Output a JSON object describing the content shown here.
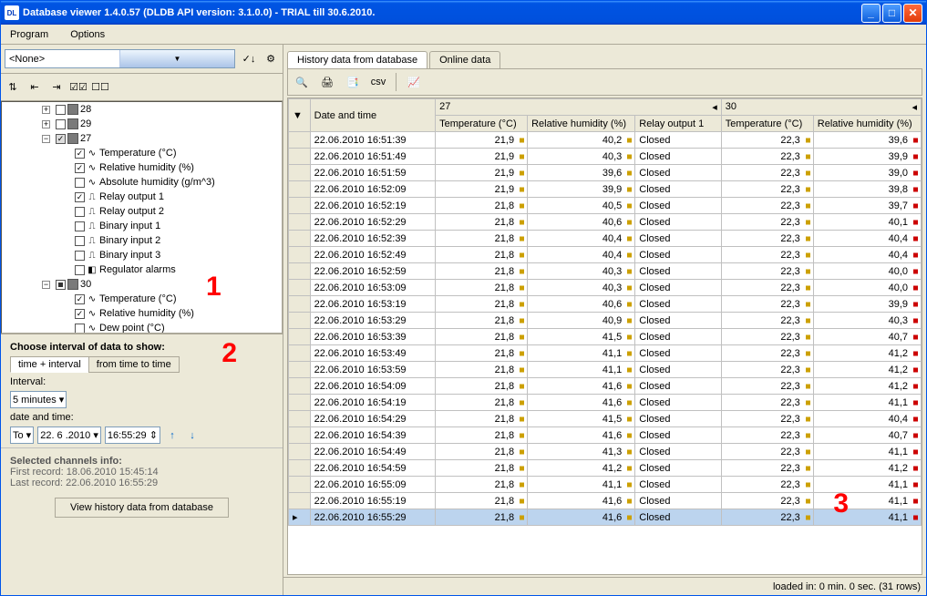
{
  "window": {
    "title": "Database viewer  1.4.0.57  (DLDB API version: 3.1.0.0) - TRIAL till 30.6.2010."
  },
  "menu": {
    "program": "Program",
    "options": "Options"
  },
  "topfilter": {
    "value": "<None>"
  },
  "tree": {
    "n28": "28",
    "n29": "29",
    "n27": "27",
    "n30": "30",
    "temp": "Temperature (°C)",
    "rh": "Relative humidity (%)",
    "ah": "Absolute humidity (g/m^3)",
    "ro1": "Relay output 1",
    "ro2": "Relay output 2",
    "bi1": "Binary input 1",
    "bi2": "Binary input 2",
    "bi3": "Binary input 3",
    "ra": "Regulator alarms",
    "dp": "Dew point (°C)"
  },
  "annot": {
    "a1": "1",
    "a2": "2",
    "a3": "3"
  },
  "interval": {
    "header": "Choose interval of data to show:",
    "tab1": "time + interval",
    "tab2": "from time to time",
    "interval_label": "Interval:",
    "interval_value": "5 minutes",
    "dt_label": "date and time:",
    "dir": "To",
    "date": "22. 6 .2010",
    "time": "16:55:29"
  },
  "info": {
    "header": "Selected channels info:",
    "first": "First record:  18.06.2010  15:45:14",
    "last": "Last record:  22.06.2010  16:55:29",
    "button": "View history data from database"
  },
  "rtabs": {
    "t1": "History data from database",
    "t2": "Online data"
  },
  "grid": {
    "col_dt": "Date and time",
    "grp1": "27",
    "grp2": "30",
    "c_temp": "Temperature (°C)",
    "c_rh": "Relative humidity (%)",
    "c_ro": "Relay output 1",
    "rows": [
      {
        "dt": "22.06.2010  16:51:39",
        "t1": "21,9",
        "h1": "40,2",
        "r": "Closed",
        "t2": "22,3",
        "h2": "39,6"
      },
      {
        "dt": "22.06.2010  16:51:49",
        "t1": "21,9",
        "h1": "40,3",
        "r": "Closed",
        "t2": "22,3",
        "h2": "39,9"
      },
      {
        "dt": "22.06.2010  16:51:59",
        "t1": "21,9",
        "h1": "39,6",
        "r": "Closed",
        "t2": "22,3",
        "h2": "39,0"
      },
      {
        "dt": "22.06.2010  16:52:09",
        "t1": "21,9",
        "h1": "39,9",
        "r": "Closed",
        "t2": "22,3",
        "h2": "39,8"
      },
      {
        "dt": "22.06.2010  16:52:19",
        "t1": "21,8",
        "h1": "40,5",
        "r": "Closed",
        "t2": "22,3",
        "h2": "39,7"
      },
      {
        "dt": "22.06.2010  16:52:29",
        "t1": "21,8",
        "h1": "40,6",
        "r": "Closed",
        "t2": "22,3",
        "h2": "40,1"
      },
      {
        "dt": "22.06.2010  16:52:39",
        "t1": "21,8",
        "h1": "40,4",
        "r": "Closed",
        "t2": "22,3",
        "h2": "40,4"
      },
      {
        "dt": "22.06.2010  16:52:49",
        "t1": "21,8",
        "h1": "40,4",
        "r": "Closed",
        "t2": "22,3",
        "h2": "40,4"
      },
      {
        "dt": "22.06.2010  16:52:59",
        "t1": "21,8",
        "h1": "40,3",
        "r": "Closed",
        "t2": "22,3",
        "h2": "40,0"
      },
      {
        "dt": "22.06.2010  16:53:09",
        "t1": "21,8",
        "h1": "40,3",
        "r": "Closed",
        "t2": "22,3",
        "h2": "40,0"
      },
      {
        "dt": "22.06.2010  16:53:19",
        "t1": "21,8",
        "h1": "40,6",
        "r": "Closed",
        "t2": "22,3",
        "h2": "39,9"
      },
      {
        "dt": "22.06.2010  16:53:29",
        "t1": "21,8",
        "h1": "40,9",
        "r": "Closed",
        "t2": "22,3",
        "h2": "40,3"
      },
      {
        "dt": "22.06.2010  16:53:39",
        "t1": "21,8",
        "h1": "41,5",
        "r": "Closed",
        "t2": "22,3",
        "h2": "40,7"
      },
      {
        "dt": "22.06.2010  16:53:49",
        "t1": "21,8",
        "h1": "41,1",
        "r": "Closed",
        "t2": "22,3",
        "h2": "41,2"
      },
      {
        "dt": "22.06.2010  16:53:59",
        "t1": "21,8",
        "h1": "41,1",
        "r": "Closed",
        "t2": "22,3",
        "h2": "41,2"
      },
      {
        "dt": "22.06.2010  16:54:09",
        "t1": "21,8",
        "h1": "41,6",
        "r": "Closed",
        "t2": "22,3",
        "h2": "41,2"
      },
      {
        "dt": "22.06.2010  16:54:19",
        "t1": "21,8",
        "h1": "41,6",
        "r": "Closed",
        "t2": "22,3",
        "h2": "41,1"
      },
      {
        "dt": "22.06.2010  16:54:29",
        "t1": "21,8",
        "h1": "41,5",
        "r": "Closed",
        "t2": "22,3",
        "h2": "40,4"
      },
      {
        "dt": "22.06.2010  16:54:39",
        "t1": "21,8",
        "h1": "41,6",
        "r": "Closed",
        "t2": "22,3",
        "h2": "40,7"
      },
      {
        "dt": "22.06.2010  16:54:49",
        "t1": "21,8",
        "h1": "41,3",
        "r": "Closed",
        "t2": "22,3",
        "h2": "41,1"
      },
      {
        "dt": "22.06.2010  16:54:59",
        "t1": "21,8",
        "h1": "41,2",
        "r": "Closed",
        "t2": "22,3",
        "h2": "41,2"
      },
      {
        "dt": "22.06.2010  16:55:09",
        "t1": "21,8",
        "h1": "41,1",
        "r": "Closed",
        "t2": "22,3",
        "h2": "41,1"
      },
      {
        "dt": "22.06.2010  16:55:19",
        "t1": "21,8",
        "h1": "41,6",
        "r": "Closed",
        "t2": "22,3",
        "h2": "41,1"
      },
      {
        "dt": "22.06.2010  16:55:29",
        "t1": "21,8",
        "h1": "41,6",
        "r": "Closed",
        "t2": "22,3",
        "h2": "41,1",
        "sel": true
      }
    ]
  },
  "status": "loaded in:   0 min. 0 sec. (31 rows)"
}
